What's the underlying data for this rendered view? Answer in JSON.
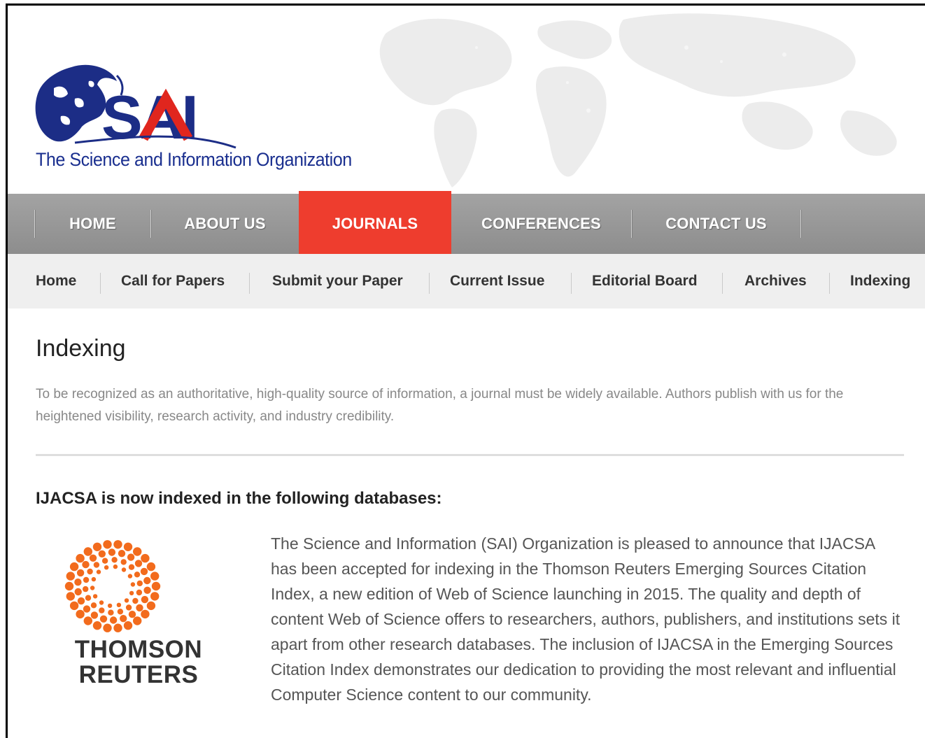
{
  "org": {
    "logo_text": "SAI",
    "tagline": "The Science and Information Organization"
  },
  "main_nav": [
    {
      "label": "HOME",
      "active": false
    },
    {
      "label": "ABOUT US",
      "active": false
    },
    {
      "label": "JOURNALS",
      "active": true
    },
    {
      "label": "CONFERENCES",
      "active": false
    },
    {
      "label": "CONTACT US",
      "active": false
    }
  ],
  "sub_nav": [
    {
      "label": "Home"
    },
    {
      "label": "Call for Papers"
    },
    {
      "label": "Submit your Paper"
    },
    {
      "label": "Current Issue"
    },
    {
      "label": "Editorial Board"
    },
    {
      "label": "Archives"
    },
    {
      "label": "Indexing"
    }
  ],
  "page": {
    "title": "Indexing",
    "intro": "To be recognized as an authoritative, high-quality source of information, a journal must be widely available. Authors publish with us for the heightened visibility, research activity, and industry credibility.",
    "section_heading": "IJACSA is now indexed in the following databases:",
    "thomson": {
      "line1": "THOMSON",
      "line2": "REUTERS"
    },
    "body": "The Science and Information (SAI) Organization is pleased to announce that IJACSA has been accepted for indexing in the Thomson Reuters Emerging Sources Citation Index, a new edition of Web of Science launching in 2015. The quality and depth of content Web of Science offers to researchers, authors, publishers, and institutions sets it apart from other research databases. The inclusion of IJACSA in the Emerging Sources Citation Index demonstrates our dedication to providing the most relevant and influential Computer Science content to our community."
  },
  "colors": {
    "nav_bg": "#999999",
    "nav_active": "#ee3d2e",
    "brand_blue": "#1a2f8f",
    "brand_red": "#e0261e",
    "reuters_orange": "#f26b1d"
  }
}
